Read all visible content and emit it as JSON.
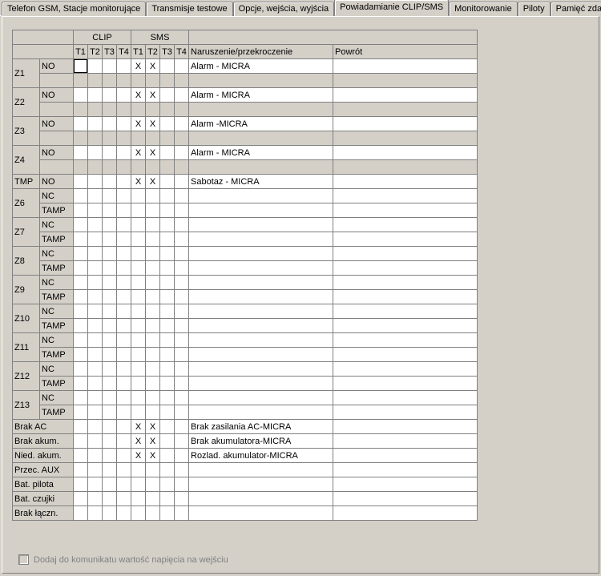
{
  "tabs": {
    "t0": "Telefon GSM, Stacje monitorujące",
    "t1": "Transmisje testowe",
    "t2": "Opcje, wejścia, wyjścia",
    "t3": "Powiadamianie CLIP/SMS",
    "t4": "Monitorowanie",
    "t5": "Piloty",
    "t6": "Pamięć zdarzeń"
  },
  "headers": {
    "clip": "CLIP",
    "sms": "SMS",
    "t1": "T1",
    "t2": "T2",
    "t3": "T3",
    "t4": "T4",
    "nar": "Naruszenie/przekroczenie",
    "pow": "Powrót"
  },
  "zoneLabels": {
    "z1": "Z1",
    "z2": "Z2",
    "z3": "Z3",
    "z4": "Z4",
    "z5": "TMP",
    "z6": "Z6",
    "z7": "Z7",
    "z8": "Z8",
    "z9": "Z9",
    "z10": "Z10",
    "z11": "Z11",
    "z12": "Z12",
    "z13": "Z13"
  },
  "extraLabels": {
    "e0": "Brak AC",
    "e1": "Brak akum.",
    "e2": "Nied. akum.",
    "e3": "Przec. AUX",
    "e4": "Bat. pilota",
    "e5": "Bat. czujki",
    "e6": "Brak łączn."
  },
  "types": {
    "no": "NO",
    "nc": "NC",
    "tamp": "TAMP"
  },
  "x": "X",
  "rows": {
    "z1": {
      "type": "no",
      "st1": "X",
      "st2": "X",
      "nar": "Alarm - MICRA"
    },
    "z2": {
      "type": "no",
      "st1": "X",
      "st2": "X",
      "nar": "Alarm - MICRA"
    },
    "z3": {
      "type": "no",
      "st1": "X",
      "st2": "X",
      "nar": "Alarm -MICRA"
    },
    "z4": {
      "type": "no",
      "st1": "X",
      "st2": "X",
      "nar": "Alarm - MICRA"
    },
    "z5": {
      "type": "no",
      "st1": "X",
      "st2": "X",
      "nar": "Sabotaz - MICRA"
    },
    "e0": {
      "st1": "X",
      "st2": "X",
      "nar": "Brak zasilania AC-MICRA"
    },
    "e1": {
      "st1": "X",
      "st2": "X",
      "nar": "Brak akumulatora-MICRA"
    },
    "e2": {
      "st1": "X",
      "st2": "X",
      "nar": "Rozlad. akumulator-MICRA"
    }
  },
  "checkbox": {
    "label": "Dodaj do komunikatu wartość napięcia na wejściu"
  }
}
